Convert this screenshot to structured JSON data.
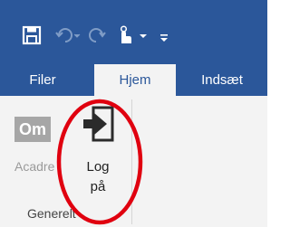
{
  "quick_access": {
    "save_icon": "save-icon",
    "undo_icon": "undo-icon",
    "redo_icon": "redo-icon",
    "touch_mode_icon": "touch-mode-icon",
    "customize_icon": "customize-quick-access-icon"
  },
  "tabs": [
    {
      "label": "Filer"
    },
    {
      "label": "Hjem"
    },
    {
      "label": "Indsæt"
    }
  ],
  "ribbon": {
    "om_label": "Om",
    "acadre_label": "Acadre",
    "log_on_label": "Log på",
    "group_label": "Generelt"
  },
  "annotation": {
    "color": "#e0000f"
  },
  "colors": {
    "accent": "#2b579a",
    "ribbon_bg": "#f3f3f3"
  }
}
